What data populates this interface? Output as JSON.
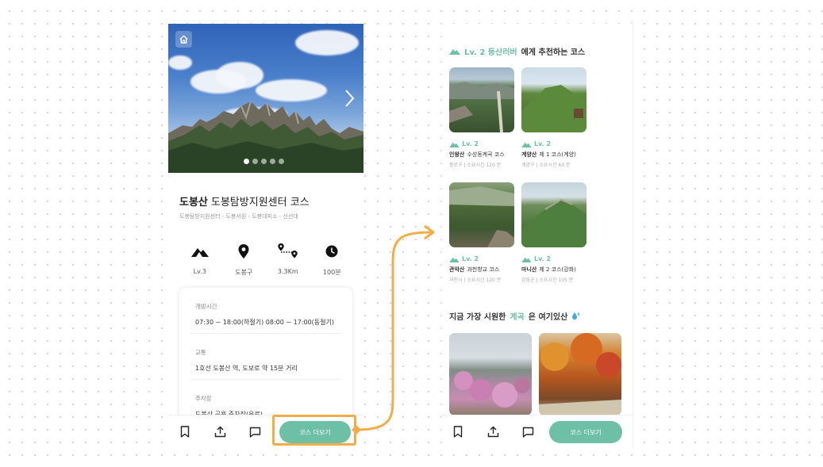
{
  "detail": {
    "title": "도봉산",
    "subtitle": "도봉탐방지원센터 코스",
    "route": "도봉탐방지원센터 - 도봉서원 - 도봉대피소 - 신선대",
    "carousel": {
      "dots": 5,
      "active": 1
    },
    "stats": [
      {
        "icon": "mountain-icon",
        "label": "Lv.3"
      },
      {
        "icon": "location-pin-icon",
        "label": "도봉구"
      },
      {
        "icon": "route-icon",
        "label": "3.3Km"
      },
      {
        "icon": "clock-icon",
        "label": "100분"
      }
    ],
    "info": [
      {
        "key": "개방시간",
        "value": "07:30 ~ 18:00(하절기) 08:00 ~ 17:00(동절기)"
      },
      {
        "key": "교통",
        "value": "1호선 도봉산 역, 도보로 약 15분 거리"
      },
      {
        "key": "주차장",
        "value": "도봉산 공용 주차장(유료)"
      }
    ],
    "more_button": "코스 더보기"
  },
  "recommend": {
    "title_level": "Lv. 2 등산러버",
    "title_rest": "에게 추천하는 코스",
    "courses": [
      {
        "level": "Lv. 2",
        "name": "인왕산",
        "course": "수성동계곡 코스",
        "meta": "종로구 | 소요시간 120 분"
      },
      {
        "level": "Lv. 2",
        "name": "계양산",
        "course": "제 1 코스(계양)",
        "meta": "계양구 | 소요시간 60 분"
      },
      {
        "level": "Lv. 2",
        "name": "관악산",
        "course": "과천향교 코스",
        "meta": "과천시 | 소요시간 120 분"
      },
      {
        "level": "Lv. 2",
        "name": "마니산",
        "course": "제 2 코스(강화)",
        "meta": "강화군 | 소요시간 105 분"
      }
    ],
    "valley_title_pre": "지금 가장 시원한",
    "valley_title_accent": "계곡",
    "valley_title_post": "은 여기있산",
    "more_button": "코스 더보기"
  },
  "colors": {
    "accent": "#6dbfa6",
    "highlight": "#f2ac48"
  }
}
